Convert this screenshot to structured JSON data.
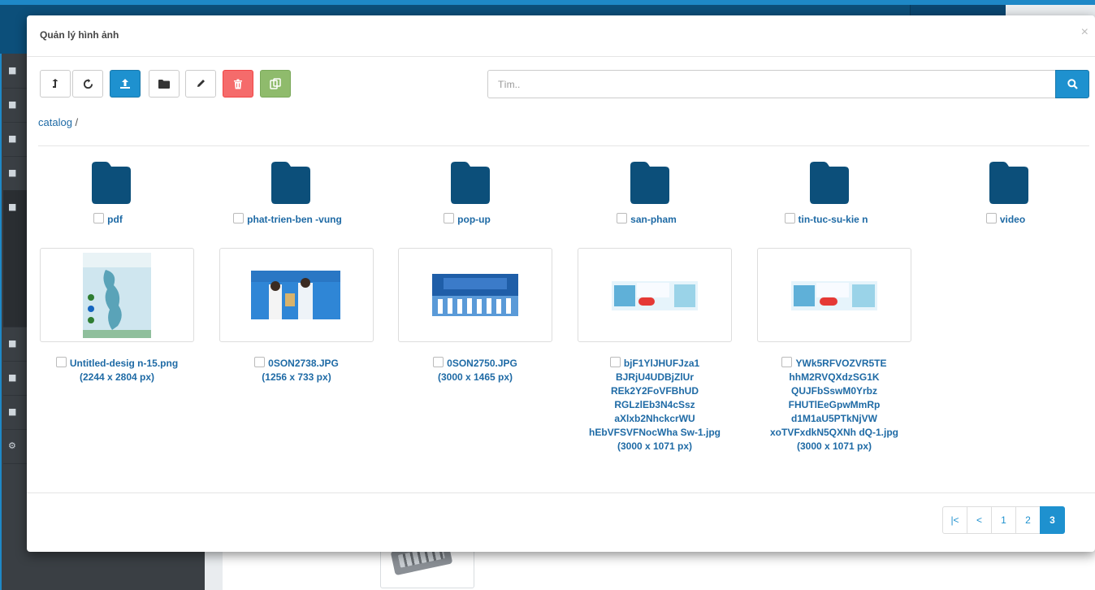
{
  "modal": {
    "title": "Quản lý hình ảnh",
    "close": "×"
  },
  "toolbar": {
    "buttons": [
      {
        "icon": "level-up-icon"
      },
      {
        "icon": "refresh-icon"
      },
      {
        "icon": "upload-icon"
      },
      {
        "icon": "folder-icon"
      },
      {
        "icon": "pencil-icon"
      },
      {
        "icon": "trash-icon"
      },
      {
        "icon": "copy-icon"
      }
    ],
    "colors": {
      "primary": "#1e91cf",
      "danger": "#f56b6b",
      "success": "#8fbb6c"
    }
  },
  "search": {
    "placeholder": "Tìm..",
    "value": ""
  },
  "breadcrumb": {
    "link": "catalog",
    "separator": "/"
  },
  "folders": [
    {
      "name": "pdf"
    },
    {
      "name": "phat-trien-ben -vung"
    },
    {
      "name": "pop-up"
    },
    {
      "name": "san-pham"
    },
    {
      "name": "tin-tuc-su-kie n"
    },
    {
      "name": "video"
    }
  ],
  "images": [
    {
      "lines": [
        "Untitled-desig n-15.png"
      ],
      "size": "(2244 x 2804 px)"
    },
    {
      "lines": [
        "0SON2738.JPG"
      ],
      "size": "(1256 x 733 px)"
    },
    {
      "lines": [
        "0SON2750.JPG"
      ],
      "size": "(3000 x 1465 px)"
    },
    {
      "lines": [
        "bjF1YlJHUFJza1",
        "BJRjU4UDBjZlUr",
        "REk2Y2FoVFBhUD",
        "RGLzlEb3N4cSsz",
        "aXlxb2NhckcrWU",
        "hEbVFSVFNocWha Sw-1.jpg"
      ],
      "size": "(3000 x 1071 px)"
    },
    {
      "lines": [
        "YWk5RFVOZVR5TE",
        "hhM2RVQXdzSG1K",
        "QUJFbSswM0Yrbz",
        "FHUTlEeGpwMmRp",
        "d1M1aU5PTkNjVW",
        "xoTVFxdkN5QXNh dQ-1.jpg"
      ],
      "size": "(3000 x 1071 px)"
    }
  ],
  "pagination": {
    "first": "|<",
    "prev": "<",
    "pages": [
      "1",
      "2",
      "3"
    ],
    "active": "3"
  },
  "folder_color": "#0c4f7a"
}
